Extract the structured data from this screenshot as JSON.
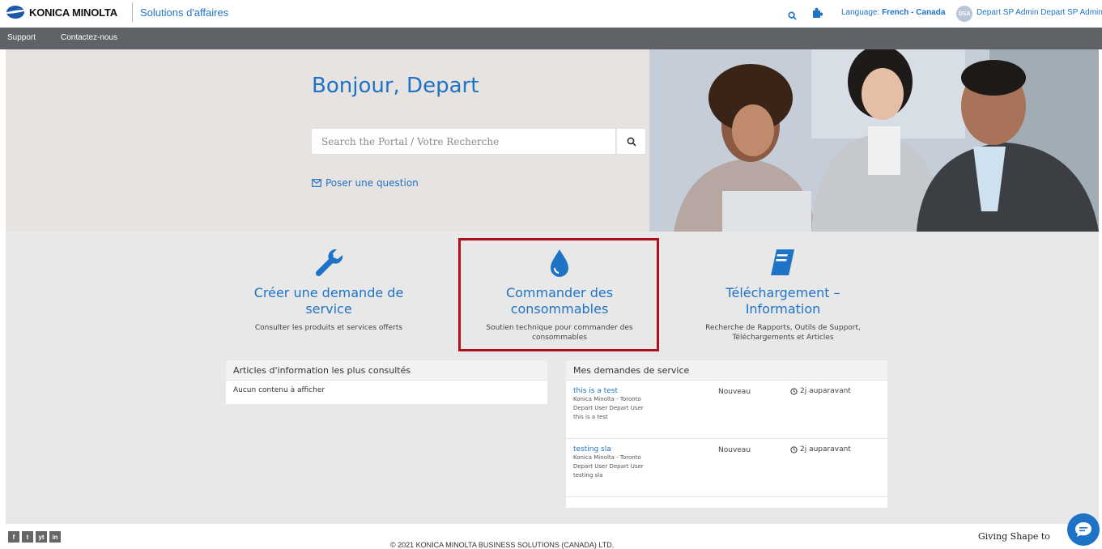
{
  "header": {
    "logo_text": "KONICA MINOLTA",
    "logo_sub": "Solutions d'affaires",
    "language_label": "Language:",
    "language_value": "French - Canada",
    "avatar_initials": "DSA",
    "username": "Depart SP Admin Depart SP Admin"
  },
  "nav": {
    "items": [
      {
        "label": "Support"
      },
      {
        "label": "Contactez-nous"
      }
    ]
  },
  "hero": {
    "greeting": "Bonjour, Depart",
    "search_placeholder": "Search the Portal / Votre Recherche",
    "ask_label": "Poser une question"
  },
  "tiles": [
    {
      "title": "Créer une demande de service",
      "desc": "Consulter les produits et services offerts",
      "icon": "wrench-icon"
    },
    {
      "title": "Commander des consommables",
      "desc": "Soutien technique pour commander des consommables",
      "icon": "droplet-icon"
    },
    {
      "title": "Téléchargement – Information",
      "desc": "Recherche de Rapports, Outils de Support, Téléchargements et Articles",
      "icon": "book-icon"
    }
  ],
  "articles": {
    "heading": "Articles d'information les plus consultés",
    "empty": "Aucun contenu à afficher"
  },
  "requests": {
    "heading": "Mes demandes de service",
    "items": [
      {
        "title": "this is a test",
        "location": "Konica Minolta - Toronto",
        "user": "Depart User Depart User",
        "summary": "this is a test",
        "status": "Nouveau",
        "time": "2j auparavant"
      },
      {
        "title": "testing sla",
        "location": "Konica Minolta - Toronto",
        "user": "Depart User Depart User",
        "summary": "testing sla",
        "status": "Nouveau",
        "time": "2j auparavant"
      }
    ]
  },
  "footer": {
    "social": [
      "f",
      "t",
      "yt",
      "in"
    ],
    "copyright": "© 2021 KONICA MINOLTA BUSINESS SOLUTIONS (CANADA) LTD.",
    "tagline": "Giving Shape to"
  },
  "colors": {
    "accent": "#1f73c7",
    "nav_bg": "#5f6367",
    "highlight": "#b10e1b"
  }
}
